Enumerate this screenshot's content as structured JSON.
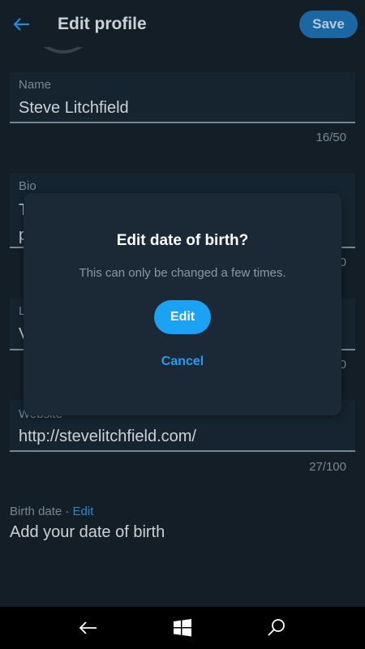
{
  "header": {
    "title": "Edit profile",
    "save_label": "Save",
    "back_icon": "back-arrow-icon"
  },
  "fields": {
    "name": {
      "label": "Name",
      "value": "Steve Litchfield",
      "counter": "16/50"
    },
    "bio": {
      "label": "Bio",
      "value_line1": "T",
      "value_line2": "p",
      "counter": "0"
    },
    "location": {
      "label": "L",
      "value": "V",
      "counter": "0"
    },
    "website": {
      "label": "Website",
      "value": "http://stevelitchfield.com/",
      "counter": "27/100"
    }
  },
  "birth": {
    "label": "Birth date · ",
    "edit_label": "Edit",
    "value": "Add your date of birth"
  },
  "dialog": {
    "title": "Edit date of birth?",
    "message": "This can only be changed a few times.",
    "edit_label": "Edit",
    "cancel_label": "Cancel"
  },
  "navbar": {
    "items": [
      "back-icon",
      "windows-start-icon",
      "search-icon"
    ]
  },
  "colors": {
    "background": "#15202b",
    "accent": "#1da1f2",
    "muted_text": "#8899a6",
    "dialog_bg": "#1b2836"
  }
}
